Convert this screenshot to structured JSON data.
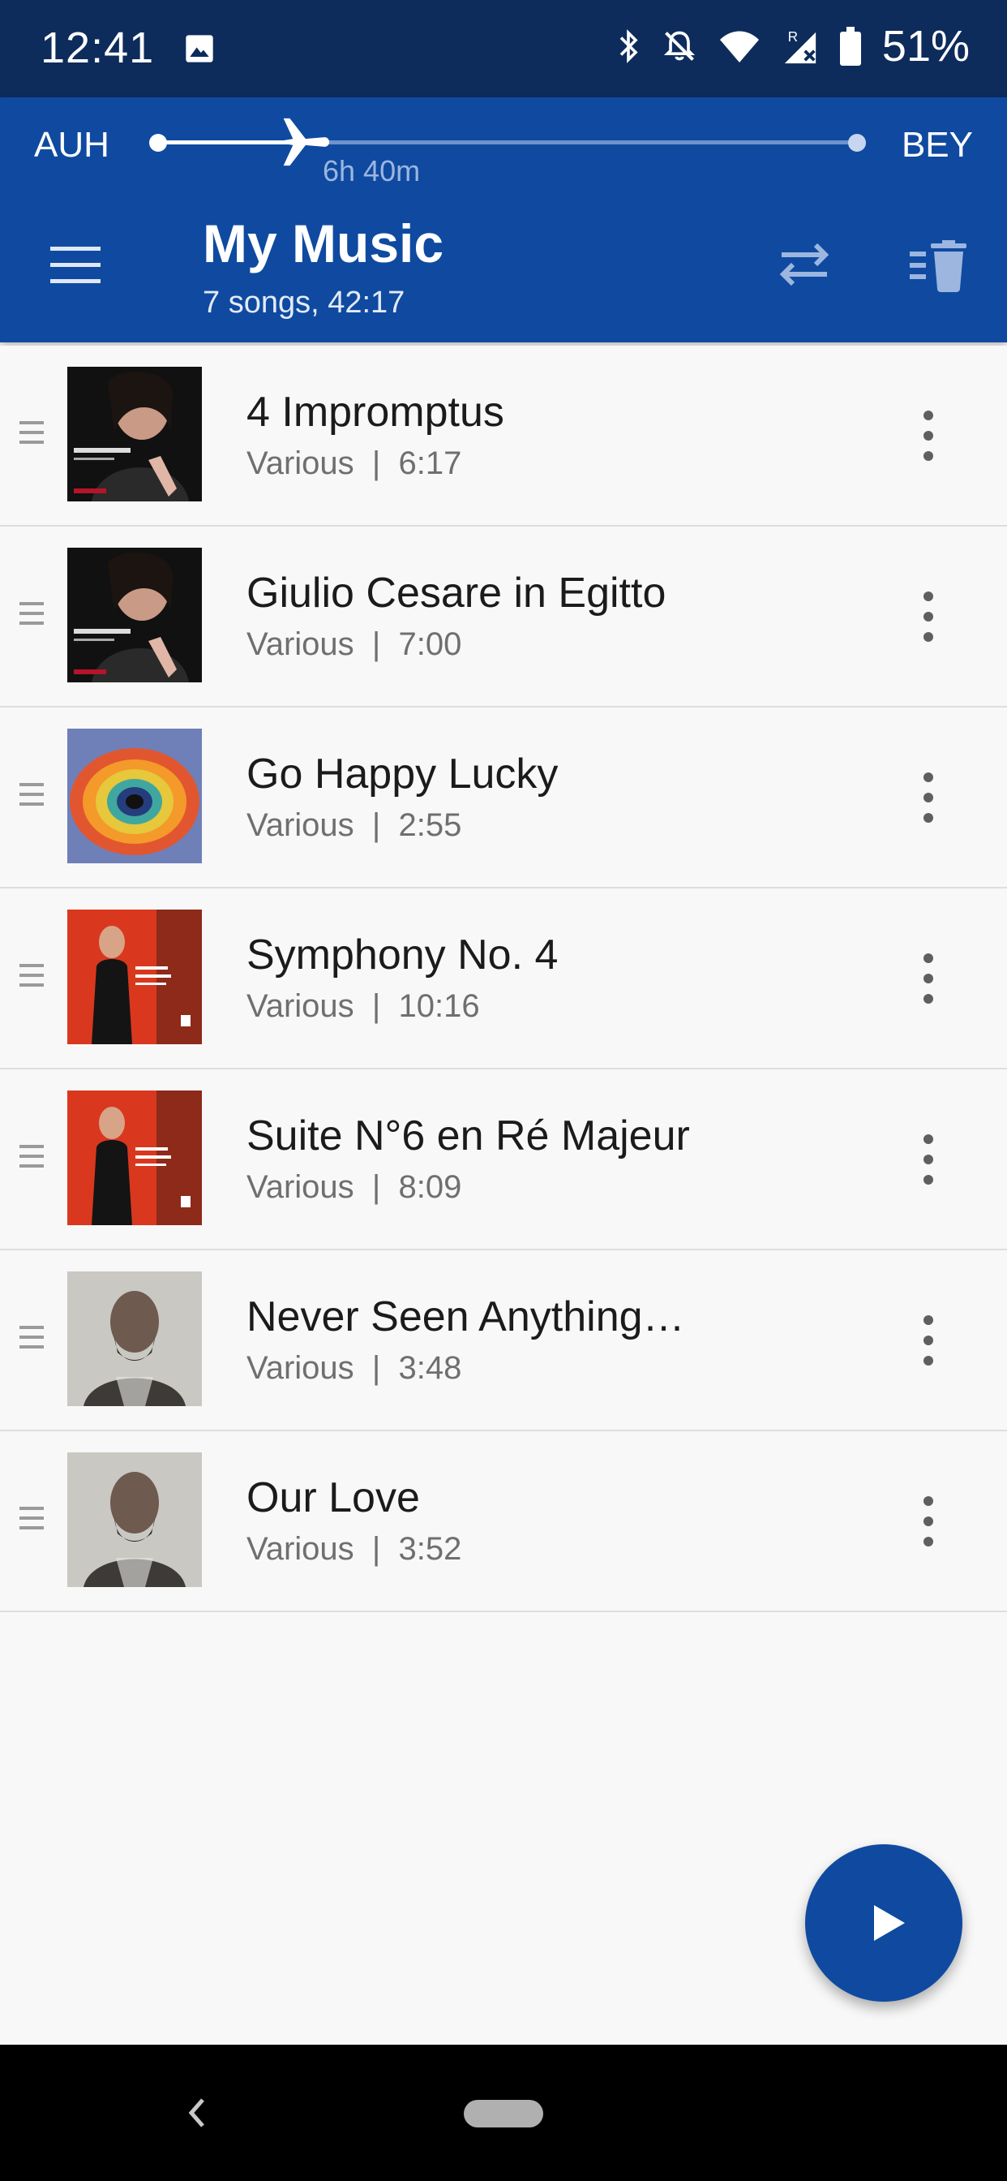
{
  "status_bar": {
    "time": "12:41",
    "battery_percent": "51%",
    "icons": [
      "image-icon",
      "bluetooth-icon",
      "notifications-off-icon",
      "wifi-icon",
      "signal-roaming-icon",
      "battery-icon"
    ]
  },
  "flight": {
    "origin": "AUH",
    "destination": "BEY",
    "remaining": "6h 40m",
    "progress_fraction": 0.24
  },
  "header": {
    "title": "My Music",
    "subtitle": "7 songs, 42:17",
    "icons": [
      "menu-icon",
      "shuffle-icon",
      "clear-playlist-icon"
    ]
  },
  "songs": [
    {
      "title": "4 Impromptus",
      "artist": "Various",
      "duration": "6:17",
      "cover": "olga-peretyatko-mozart"
    },
    {
      "title": "Giulio Cesare in Egitto",
      "artist": "Various",
      "duration": "7:00",
      "cover": "olga-peretyatko-mozart"
    },
    {
      "title": "Go Happy Lucky",
      "artist": "Various",
      "duration": "2:55",
      "cover": "concentric-rings"
    },
    {
      "title": "Symphony No. 4",
      "artist": "Various",
      "duration": "10:16",
      "cover": "xavier-de-maistre"
    },
    {
      "title": "Suite N°6 en Ré Majeur",
      "artist": "Various",
      "duration": "8:09",
      "cover": "xavier-de-maistre"
    },
    {
      "title": "Never Seen Anything…",
      "artist": "Various",
      "duration": "3:48",
      "cover": "portrait-grey"
    },
    {
      "title": "Our Love",
      "artist": "Various",
      "duration": "3:52",
      "cover": "portrait-grey"
    }
  ],
  "meta_separator": "|",
  "colors": {
    "status_bar": "#0d2c5c",
    "header": "#0f4aa0",
    "fab": "#0f4aa0",
    "background": "#f8f8f8"
  }
}
